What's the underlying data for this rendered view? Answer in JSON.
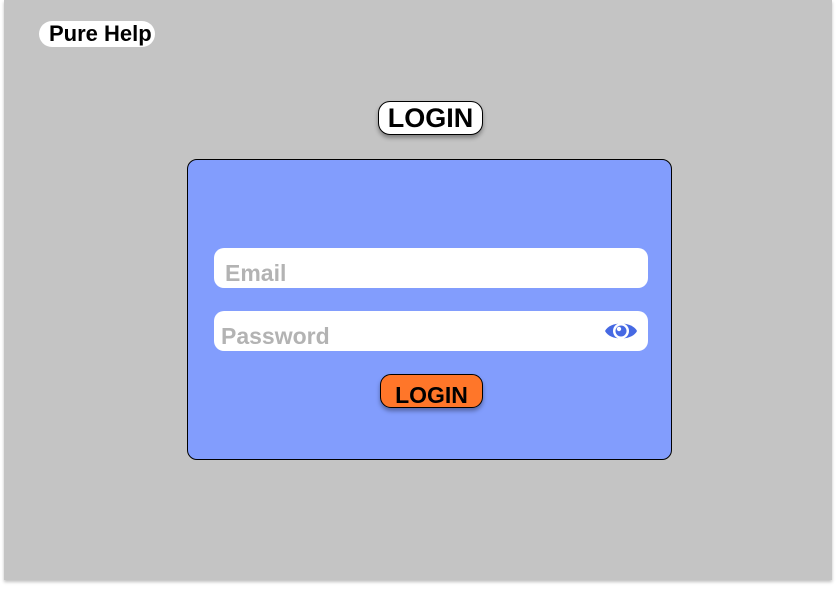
{
  "app": {
    "brand": "Pure Help"
  },
  "page": {
    "title": "LOGIN"
  },
  "login_form": {
    "email": {
      "value": "",
      "placeholder": "Email"
    },
    "password": {
      "value": "",
      "placeholder": "Password",
      "toggle_icon": "eye-icon"
    },
    "submit_label": "LOGIN"
  },
  "colors": {
    "background": "#c4c4c4",
    "card": "#829dfd",
    "field": "#ffffff",
    "placeholder": "#b3b3b3",
    "button": "#ff7629",
    "eye_icon": "#4669e3"
  }
}
